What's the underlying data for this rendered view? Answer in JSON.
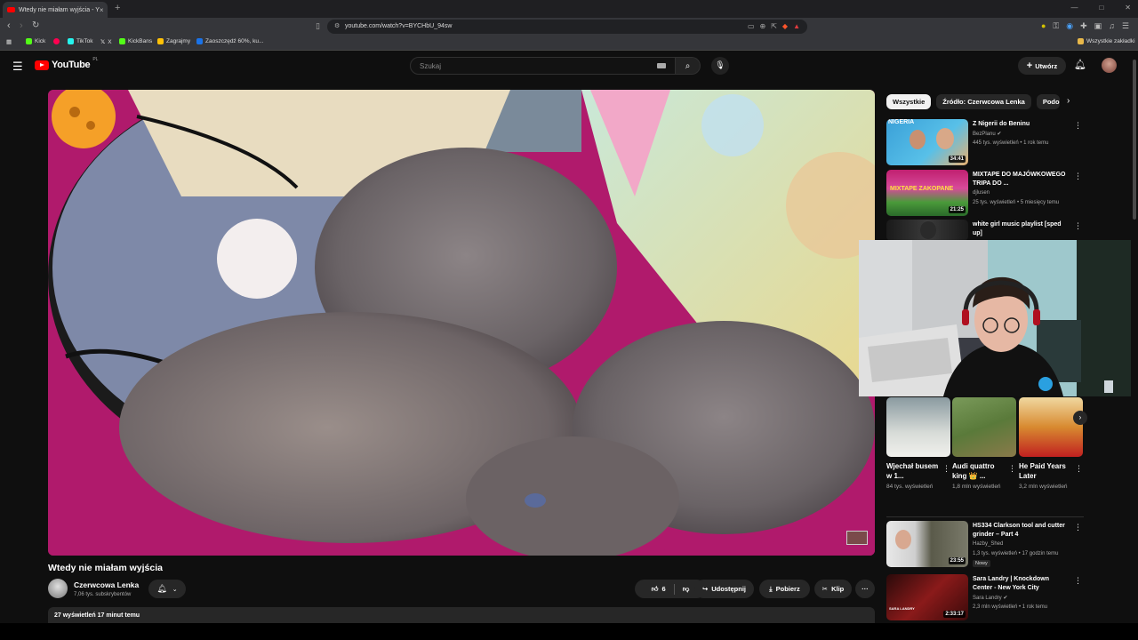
{
  "browser": {
    "tab_title": "Wtedy nie miałam wyjścia - Y",
    "tab_close": "×",
    "new_tab": "+",
    "url": "youtube.com/watch?v=BYCHbU_94sw",
    "bookmarks": [
      {
        "label": "Kick",
        "color": "#53fc18"
      },
      {
        "label": "",
        "color": "#ff0050"
      },
      {
        "label": "TikTok",
        "color": "#25f4ee"
      },
      {
        "label": "X",
        "color": "#ffffff"
      },
      {
        "label": "KickBans",
        "color": "#53fc18"
      },
      {
        "label": "Zagrajmy",
        "color": "#ffc107"
      },
      {
        "label": "Zaoszczędź 60%, ku...",
        "color": "#1a73e8"
      }
    ],
    "bookmarks_all": "Wszystkie zakładki"
  },
  "youtube": {
    "logo_text": "YouTube",
    "logo_region": "PL",
    "search_placeholder": "Szukaj",
    "create_label": "Utwórz"
  },
  "video": {
    "title": "Wtedy nie miałam wyjścia",
    "channel_name": "Czerwcowa Lenka",
    "channel_subs": "7,06 tys. subskrybentów",
    "likes": "6",
    "share_label": "Udostępnij",
    "download_label": "Pobierz",
    "clip_label": "Klip",
    "more_label": "···",
    "description_summary": "27 wyświetleń  17 minut temu"
  },
  "sidebar": {
    "chips": [
      "Wszystkie",
      "Źródło: Czerwcowa Lenka",
      "Podobne"
    ],
    "recommendations_top": [
      {
        "title": "Z Nigerii do Beninu",
        "channel": "BezPlanu ✔",
        "meta": "445 tys. wyświetleń • 1 rok temu",
        "duration": "34:41",
        "thumb_text": "NIGERIA"
      },
      {
        "title": "MIXTAPE DO MAJÓWKOWEGO TRIPA DO ...",
        "channel": "djlusen",
        "meta": "25 tys. wyświetleń • 5 miesięcy temu",
        "duration": "21:25",
        "thumb_text": "MIXTAPE ZAKOPANE"
      },
      {
        "title": "white girl music playlist [sped up]",
        "channel": "",
        "meta": "",
        "duration": "",
        "thumb_text": ""
      }
    ],
    "shorts": [
      {
        "title": "Wjechał busem w 1...",
        "views": "84 tys. wyświetleń"
      },
      {
        "title": "Audi quattro king 👑 ...",
        "views": "1,8 mln wyświetleń"
      },
      {
        "title": "He Paid Years Later",
        "views": "3,2 mln wyświetleń"
      }
    ],
    "recommendations_bottom": [
      {
        "title": "HS334 Clarkson tool and cutter grinder – Part 4",
        "channel": "Hazby_Shed",
        "meta": "1,3 tys. wyświetleń • 17 godzin temu",
        "duration": "23:55",
        "badge": "Nowy"
      },
      {
        "title": "Sara Landry | Knockdown Center - New York City",
        "channel": "Sara Landry ✔",
        "meta": "2,3 mln wyświetleń • 1 rok temu",
        "duration": "2:33:17",
        "badge": ""
      }
    ]
  },
  "colors": {
    "bg": "#0f0f0f",
    "accent": "#ff0000",
    "chip_bg": "#272727"
  }
}
